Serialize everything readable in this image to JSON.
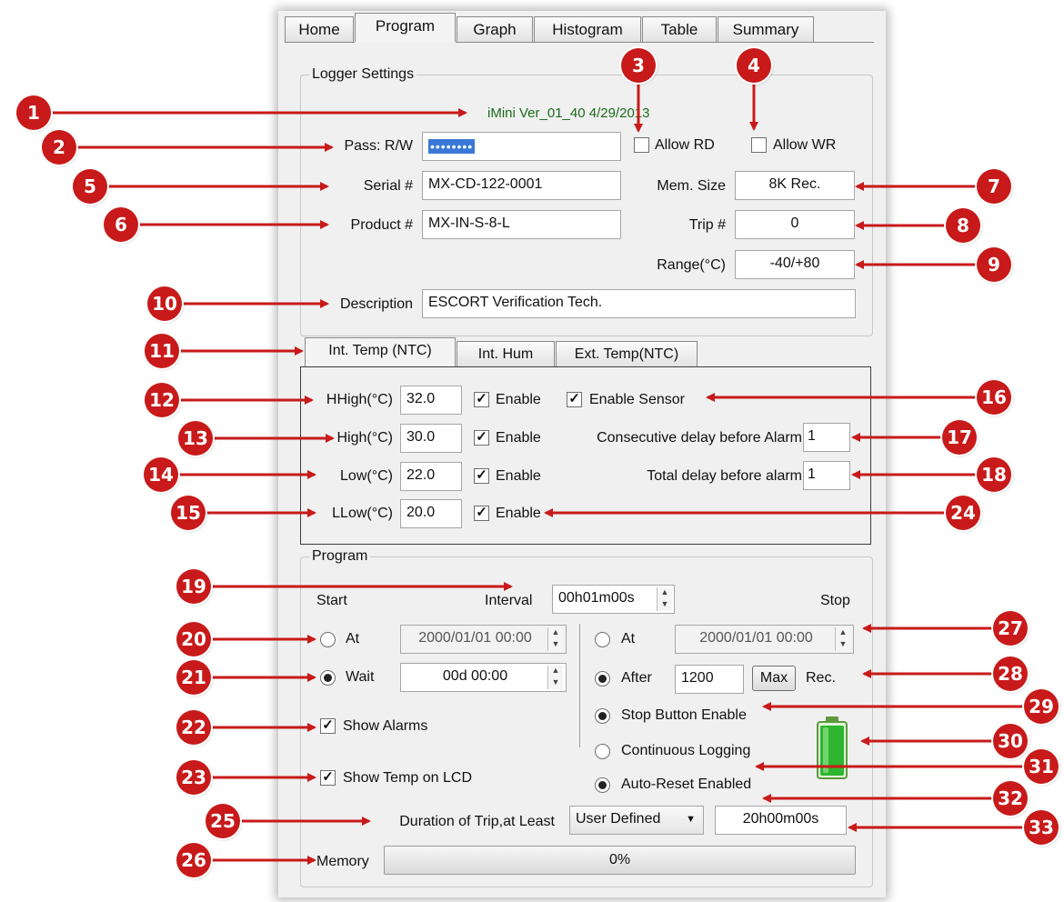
{
  "tabs": {
    "home": "Home",
    "program": "Program",
    "graph": "Graph",
    "histogram": "Histogram",
    "table": "Table",
    "summary": "Summary"
  },
  "logger_settings": {
    "legend": "Logger Settings",
    "version": "iMini Ver_01_40 4/29/2013",
    "pass_label": "Pass: R/W",
    "pass_value": "••••••••",
    "allow_rd": "Allow RD",
    "allow_wr": "Allow WR",
    "serial_label": "Serial #",
    "serial_value": "MX-CD-122-0001",
    "mem_label": "Mem. Size",
    "mem_value": "8K Rec.",
    "product_label": "Product #",
    "product_value": "MX-IN-S-8-L",
    "trip_label": "Trip #",
    "trip_value": "0",
    "range_label": "Range(°C)",
    "range_value": "-40/+80",
    "description_label": "Description",
    "description_value": "ESCORT Verification Tech."
  },
  "sensor_tabs": {
    "int_temp": "Int. Temp (NTC)",
    "int_hum": "Int. Hum",
    "ext_temp": "Ext. Temp(NTC)"
  },
  "alarms": {
    "hhigh_label": "HHigh(°C)",
    "hhigh_value": "32.0",
    "high_label": "High(°C)",
    "high_value": "30.0",
    "low_label": "Low(°C)",
    "low_value": "22.0",
    "llow_label": "LLow(°C)",
    "llow_value": "20.0",
    "enable": "Enable",
    "enable_sensor": "Enable Sensor",
    "consecutive_label": "Consecutive delay before Alarm",
    "consecutive_value": "1",
    "total_label": "Total delay before alarm",
    "total_value": "1"
  },
  "program": {
    "legend": "Program",
    "start": "Start",
    "stop": "Stop",
    "interval_label": "Interval",
    "interval_value": "00h01m00s",
    "at": "At",
    "start_at_value": "2000/01/01 00:00",
    "wait": "Wait",
    "wait_value": "00d 00:00",
    "stop_at_value": "2000/01/01 00:00",
    "after": "After",
    "after_value": "1200",
    "max": "Max",
    "rec": "Rec.",
    "show_alarms": "Show Alarms",
    "show_temp_lcd": "Show Temp on LCD",
    "stop_button_enable": "Stop Button Enable",
    "continuous_logging": "Continuous Logging",
    "auto_reset": "Auto-Reset Enabled",
    "duration_label": "Duration of Trip,at Least",
    "duration_select": "User Defined",
    "duration_value": "20h00m00s",
    "memory_label": "Memory",
    "memory_value": "0%",
    "memory_fraction": 0
  },
  "callouts": [
    "1",
    "2",
    "3",
    "4",
    "5",
    "6",
    "7",
    "8",
    "9",
    "10",
    "11",
    "12",
    "13",
    "14",
    "15",
    "16",
    "17",
    "18",
    "19",
    "20",
    "21",
    "22",
    "23",
    "24",
    "25",
    "26",
    "27",
    "28",
    "29",
    "30",
    "31",
    "32",
    "33"
  ],
  "colors": {
    "callout": "#c81a1a",
    "version_text": "#1a6b1a",
    "battery": "#2fb52f"
  }
}
